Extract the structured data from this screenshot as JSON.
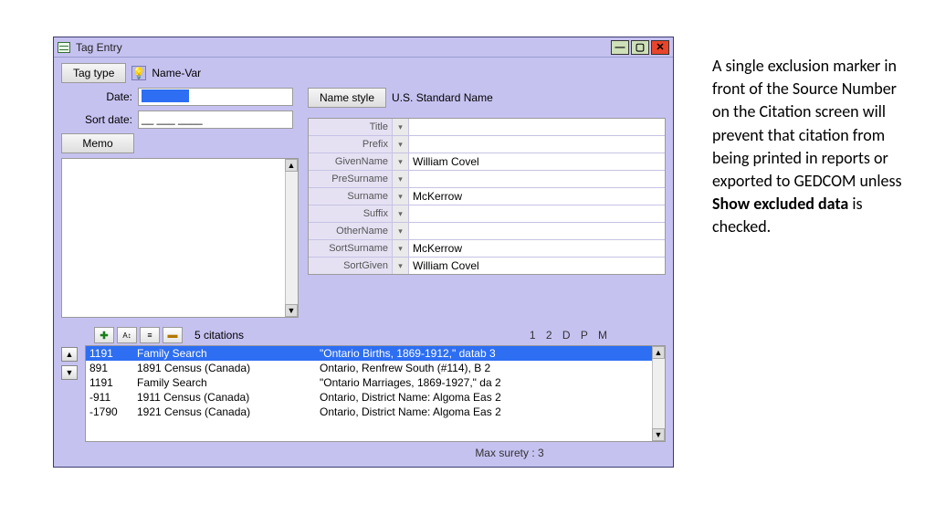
{
  "window": {
    "title": "Tag Entry",
    "buttons": {
      "min": "—",
      "max": "▢",
      "close": "✕"
    }
  },
  "toolbar": {
    "tag_type_btn": "Tag type",
    "tag_type_value": "Name-Var",
    "date_label": "Date:",
    "date_value": "",
    "sort_date_label": "Sort date:",
    "sort_date_value": "__ ___ ____",
    "memo_btn": "Memo",
    "name_style_btn": "Name style",
    "name_style_value": "U.S. Standard Name"
  },
  "name_fields": [
    {
      "label": "Title",
      "value": ""
    },
    {
      "label": "Prefix",
      "value": ""
    },
    {
      "label": "GivenName",
      "value": "William Covel"
    },
    {
      "label": "PreSurname",
      "value": ""
    },
    {
      "label": "Surname",
      "value": "McKerrow"
    },
    {
      "label": "Suffix",
      "value": ""
    },
    {
      "label": "OtherName",
      "value": ""
    },
    {
      "label": "SortSurname",
      "value": "McKerrow"
    },
    {
      "label": "SortGiven",
      "value": "William Covel"
    }
  ],
  "citations": {
    "count_label": "5  citations",
    "headers": "1 2 D P M",
    "rows": [
      {
        "num": "1191",
        "src": "Family Search",
        "det": "\"Ontario Births, 1869-1912,\" datab 3",
        "selected": true
      },
      {
        "num": "891",
        "src": "1891 Census (Canada)",
        "det": "Ontario, Renfrew South (#114), B 2",
        "selected": false
      },
      {
        "num": "1191",
        "src": "Family Search",
        "det": "\"Ontario Marriages, 1869-1927,\" da 2",
        "selected": false
      },
      {
        "num": "-911",
        "src": "1911 Census (Canada)",
        "det": "Ontario, District Name: Algoma Eas 2",
        "selected": false
      },
      {
        "num": "-1790",
        "src": "1921 Census (Canada)",
        "det": "Ontario, District Name: Algoma Eas 2",
        "selected": false
      }
    ],
    "max_surety": "Max surety :   3"
  },
  "sidecopy": {
    "p1": "A single exclusion marker in front of the Source Number on the Citation screen will prevent that citation from being printed in reports or exported to GEDCOM unless ",
    "bold": "Show excluded data",
    "p2": " is checked."
  }
}
